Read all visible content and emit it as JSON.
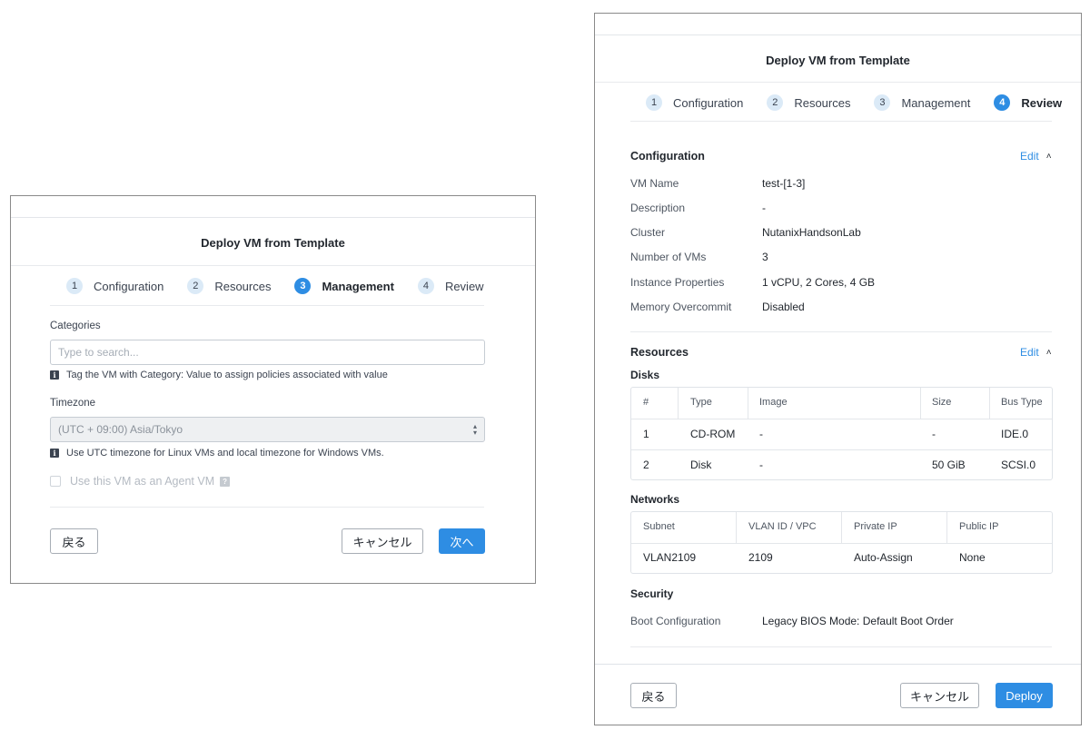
{
  "left_dialog": {
    "title": "Deploy VM from Template",
    "steps": [
      {
        "num": "1",
        "label": "Configuration"
      },
      {
        "num": "2",
        "label": "Resources"
      },
      {
        "num": "3",
        "label": "Management"
      },
      {
        "num": "4",
        "label": "Review"
      }
    ],
    "active_step": 3,
    "categories_label": "Categories",
    "categories_placeholder": "Type to search...",
    "categories_hint": "Tag the VM with Category: Value to assign policies associated with value",
    "timezone_label": "Timezone",
    "timezone_value": "(UTC + 09:00) Asia/Tokyo",
    "timezone_hint": "Use UTC timezone for Linux VMs and local timezone for Windows VMs.",
    "agent_vm_label": "Use this VM as an Agent VM",
    "back_label": "戻る",
    "cancel_label": "キャンセル",
    "next_label": "次へ"
  },
  "right_dialog": {
    "title": "Deploy VM from Template",
    "steps": [
      {
        "num": "1",
        "label": "Configuration"
      },
      {
        "num": "2",
        "label": "Resources"
      },
      {
        "num": "3",
        "label": "Management"
      },
      {
        "num": "4",
        "label": "Review"
      }
    ],
    "active_step": 4,
    "configuration": {
      "heading": "Configuration",
      "edit_label": "Edit",
      "rows": [
        {
          "key": "VM Name",
          "value": "test-[1-3]"
        },
        {
          "key": "Description",
          "value": "-"
        },
        {
          "key": "Cluster",
          "value": "NutanixHandsonLab"
        },
        {
          "key": "Number of VMs",
          "value": "3"
        },
        {
          "key": "Instance Properties",
          "value": "1 vCPU, 2 Cores, 4 GB"
        },
        {
          "key": "Memory Overcommit",
          "value": "Disabled"
        }
      ]
    },
    "resources": {
      "heading": "Resources",
      "edit_label": "Edit",
      "disks_heading": "Disks",
      "disk_columns": [
        "#",
        "Type",
        "Image",
        "Size",
        "Bus Type"
      ],
      "disk_rows": [
        [
          "1",
          "CD-ROM",
          "-",
          "-",
          "IDE.0"
        ],
        [
          "2",
          "Disk",
          "-",
          "50 GiB",
          "SCSI.0"
        ]
      ],
      "networks_heading": "Networks",
      "network_columns": [
        "Subnet",
        "VLAN ID / VPC",
        "Private IP",
        "Public IP"
      ],
      "network_rows": [
        [
          "VLAN2109",
          "2109",
          "Auto-Assign",
          "None"
        ]
      ],
      "security_heading": "Security",
      "boot_key": "Boot Configuration",
      "boot_value": "Legacy BIOS Mode: Default Boot Order"
    },
    "back_label": "戻る",
    "cancel_label": "キャンセル",
    "deploy_label": "Deploy"
  },
  "colors": {
    "accent": "#2e8de3",
    "step_inactive_bg": "#dbeaf7",
    "border": "#c6ccd3"
  }
}
